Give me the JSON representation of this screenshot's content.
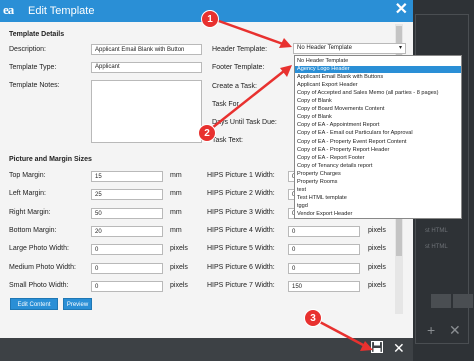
{
  "dialog": {
    "title": "Edit Template",
    "logo": "ea",
    "close_icon": "✕"
  },
  "template_details": {
    "heading": "Template Details",
    "description_label": "Description:",
    "description_value": "Applicant Email Blank with Button",
    "type_label": "Template Type:",
    "type_value": "Applicant",
    "notes_label": "Template Notes:",
    "header_label": "Header Template:",
    "header_value": "No Header Template",
    "footer_label": "Footer Template:",
    "create_task_label": "Create a Task:",
    "task_for_label": "Task For",
    "days_until_label": "Days Until Task Due:",
    "task_text_label": "Task Text:"
  },
  "picture_margin": {
    "heading": "Picture and Margin Sizes",
    "rows": [
      {
        "label": "Top Margin:",
        "value": "15",
        "unit": "mm",
        "hips_label": "HIPS Picture 1 Width:",
        "hips_value": "0",
        "hips_unit": "pixels"
      },
      {
        "label": "Left Margin:",
        "value": "25",
        "unit": "mm",
        "hips_label": "HIPS Picture 2 Width:",
        "hips_value": "0",
        "hips_unit": "pixels"
      },
      {
        "label": "Right Margin:",
        "value": "50",
        "unit": "mm",
        "hips_label": "HIPS Picture 3 Width:",
        "hips_value": "0",
        "hips_unit": "pixels"
      },
      {
        "label": "Bottom Margin:",
        "value": "20",
        "unit": "mm",
        "hips_label": "HIPS Picture 4 Width:",
        "hips_value": "0",
        "hips_unit": "pixels"
      },
      {
        "label": "Large Photo Width:",
        "value": "0",
        "unit": "pixels",
        "hips_label": "HIPS Picture 5 Width:",
        "hips_value": "0",
        "hips_unit": "pixels"
      },
      {
        "label": "Medium Photo Width:",
        "value": "0",
        "unit": "pixels",
        "hips_label": "HIPS Picture 6 Width:",
        "hips_value": "0",
        "hips_unit": "pixels"
      },
      {
        "label": "Small Photo Width:",
        "value": "0",
        "unit": "pixels",
        "hips_label": "HIPS Picture 7 Width:",
        "hips_value": "150",
        "hips_unit": "pixels"
      }
    ]
  },
  "buttons": {
    "edit_content": "Edit Content",
    "preview": "Preview"
  },
  "dropdown_options": [
    "No Header Template",
    "Agency Logo Header",
    "Applicant Email Blank with Buttons",
    "Applicant Export Header",
    "Copy of Accepted and Sales Memo (all parties - 8 pages)",
    "Copy of Blank",
    "Copy of Board Movements Content",
    "Copy of Blank",
    "Copy of EA - Appointment Report",
    "Copy of EA - Email out Particulars for Approval",
    "Copy of EA - Property Event Report Content",
    "Copy of EA - Property Report Header",
    "Copy of EA - Report Footer",
    "Copy of Tenancy details report",
    "Property Charges",
    "Property Rooms",
    "test",
    "Test HTML template",
    "tggd",
    "Vendor Export Header"
  ],
  "dropdown_highlight_index": 1,
  "badges": [
    "1",
    "2",
    "3"
  ],
  "bottom_bar": {
    "save_icon": "💾",
    "close_icon": "✕"
  },
  "background": {
    "items": [
      "st HTML",
      "st HTML"
    ]
  }
}
